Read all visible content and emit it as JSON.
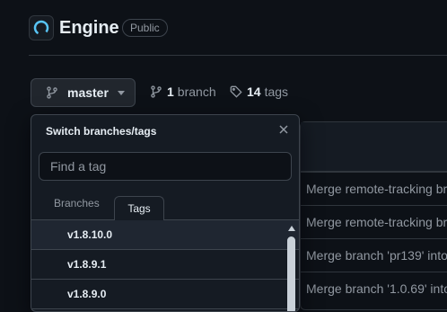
{
  "repo": {
    "name": "Engine",
    "visibility": "Public"
  },
  "branch_selector": {
    "current": "master"
  },
  "branches_link": {
    "count": "1",
    "label": "branch"
  },
  "tags_link": {
    "count": "14",
    "label": "tags"
  },
  "dropdown": {
    "title": "Switch branches/tags",
    "search_placeholder": "Find a tag",
    "tabs": [
      "Branches",
      "Tags"
    ],
    "active_tab": "Tags",
    "items": [
      "v1.8.10.0",
      "v1.8.9.1",
      "v1.8.9.0"
    ]
  },
  "commits": [
    "Merge remote-tracking branch",
    "Merge remote-tracking branch",
    "Merge branch 'pr139' into",
    "Merge branch '1.0.69' into"
  ],
  "colors": {
    "background": "#0d1117",
    "panel": "#151b23",
    "border": "#3d444d",
    "text": "#e6edf3",
    "muted": "#9198a1",
    "accent": "#1f6feb"
  }
}
